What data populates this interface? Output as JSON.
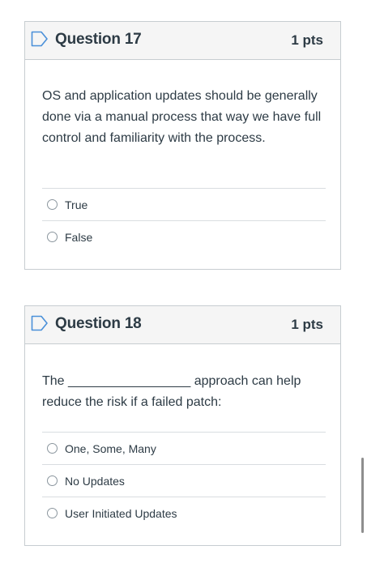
{
  "questions": [
    {
      "title": "Question 17",
      "points": "1 pts",
      "text": "OS and application updates should be generally done via a manual process that way we have full control and familiarity with the process.",
      "answers": [
        "True",
        "False"
      ]
    },
    {
      "title": "Question 18",
      "points": "1 pts",
      "text": "The _________________ approach can help reduce the risk if a failed patch:",
      "answers": [
        "One, Some, Many",
        "No Updates",
        "User Initiated Updates"
      ]
    }
  ],
  "icons": {
    "flag": "bookmark-flag-icon"
  },
  "colors": {
    "flag": "#4a90d9",
    "text": "#2d3b45",
    "header_bg": "#f5f5f5",
    "border": "#c7cdd1"
  }
}
